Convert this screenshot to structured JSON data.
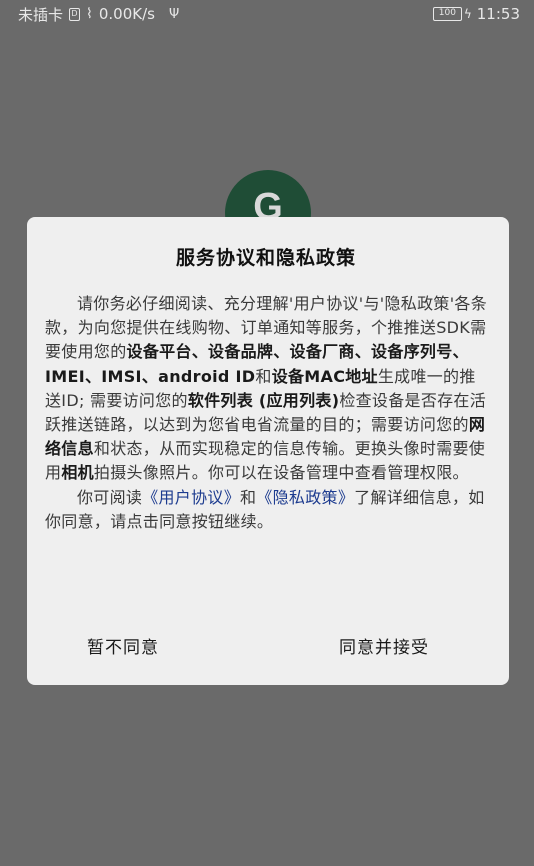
{
  "status_bar": {
    "carrier": "未插卡",
    "sim_icon": "sim-icon",
    "net_speed": "0.00K/s",
    "battery": "100",
    "time": "11:53"
  },
  "logo": {
    "letter": "G"
  },
  "dialog": {
    "title": "服务协议和隐私政策",
    "p1": {
      "s1": "请你务必仔细阅读、充分理解'用户协议'与'隐私政策'各条款，为向您提供在线购物、订单通知等服务，个推推送SDK需要使用您的",
      "b1": "设备平台、设备品牌、设备厂商、设备序列号、IMEI、IMSI、android ID",
      "s2": "和",
      "b2": "设备MAC地址",
      "s3": "生成唯一的推送ID; 需要访问您的",
      "b3": "软件列表 (应用列表)",
      "s4": "检查设备是否存在活跃推送链路，以达到为您省电省流量的目的；需要访问您的",
      "b4": "网络信息",
      "s5": "和状态，从而实现稳定的信息传输。更换头像时需要使用",
      "b5": "相机",
      "s6": "拍摄头像照片。你可以在设备管理中查看管理权限。"
    },
    "p2": {
      "s1": "你可阅读",
      "link1": "《用户协议》",
      "s2": "和",
      "link2": "《隐私政策》",
      "s3": "了解详细信息，如你同意，请点击同意按钮继续。"
    },
    "cancel_label": "暂不同意",
    "accept_label": "同意并接受"
  }
}
